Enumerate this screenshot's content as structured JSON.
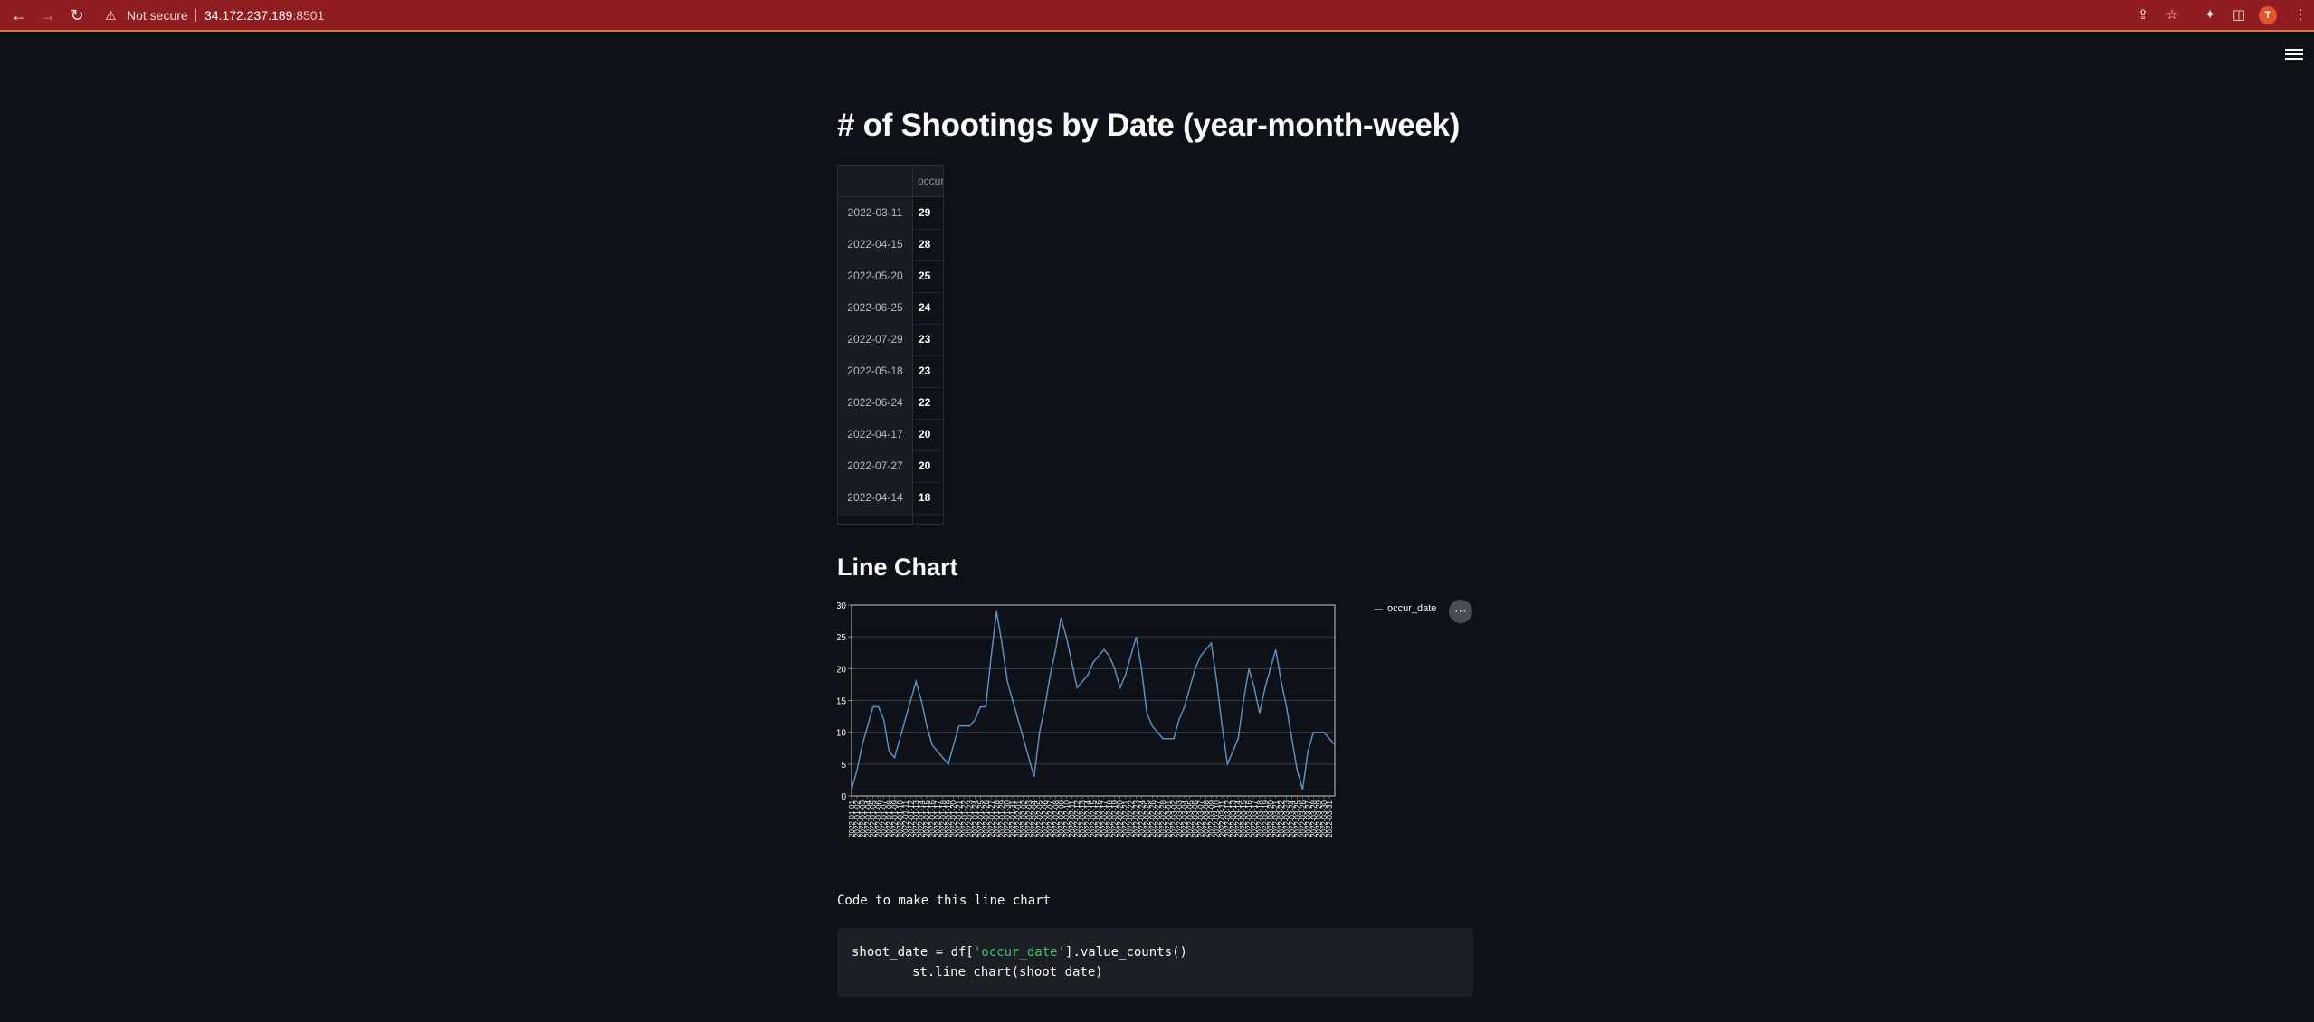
{
  "browser": {
    "security_label": "Not secure",
    "url_host": "34.172.237.189",
    "url_port": ":8501",
    "avatar_letter": "T"
  },
  "page": {
    "title": "# of Shootings by Date (year-month-week)",
    "line_chart_heading": "Line Chart",
    "code_label": "Code to make this line chart",
    "code_line1_a": "shoot_date = df[",
    "code_line1_str": "'occur_date'",
    "code_line1_b": "].value_counts()",
    "code_line2": "st.line_chart(shoot_date)"
  },
  "dataframe": {
    "column_header": "occur_date",
    "rows": [
      {
        "index": "2022-03-11",
        "value": "29"
      },
      {
        "index": "2022-04-15",
        "value": "28"
      },
      {
        "index": "2022-05-20",
        "value": "25"
      },
      {
        "index": "2022-06-25",
        "value": "24"
      },
      {
        "index": "2022-07-29",
        "value": "23"
      },
      {
        "index": "2022-05-18",
        "value": "23"
      },
      {
        "index": "2022-06-24",
        "value": "22"
      },
      {
        "index": "2022-04-17",
        "value": "20"
      },
      {
        "index": "2022-07-27",
        "value": "20"
      },
      {
        "index": "2022-04-14",
        "value": "18"
      }
    ]
  },
  "chart_data": {
    "type": "line",
    "legend": "occur_date",
    "legend_position": "top-right",
    "ylim": [
      0,
      30
    ],
    "yticks": [
      0,
      5,
      10,
      15,
      20,
      25,
      30
    ],
    "grid": true,
    "line_color": "#5c8ec0",
    "x": [
      "2022-01-01",
      "2022-01-02",
      "2022-01-03",
      "2022-01-04",
      "2022-01-05",
      "2022-01-06",
      "2022-01-07",
      "2022-01-08",
      "2022-01-09",
      "2022-01-10",
      "2022-01-11",
      "2022-01-12",
      "2022-01-13",
      "2022-01-14",
      "2022-01-15",
      "2022-01-16",
      "2022-01-17",
      "2022-01-18",
      "2022-01-19",
      "2022-01-20",
      "2022-01-21",
      "2022-01-22",
      "2022-01-23",
      "2022-01-24",
      "2022-01-25",
      "2022-01-26",
      "2022-01-27",
      "2022-01-28",
      "2022-01-29",
      "2022-01-30",
      "2022-01-31",
      "2022-02-01",
      "2022-02-02",
      "2022-02-03",
      "2022-02-04",
      "2022-02-05",
      "2022-02-06",
      "2022-02-07",
      "2022-02-08",
      "2022-02-09",
      "2022-02-10",
      "2022-02-11",
      "2022-02-12",
      "2022-02-13",
      "2022-02-14",
      "2022-02-15",
      "2022-02-16",
      "2022-02-17",
      "2022-02-18",
      "2022-02-19",
      "2022-02-20",
      "2022-02-21",
      "2022-02-22",
      "2022-02-23",
      "2022-02-24",
      "2022-02-25",
      "2022-02-26",
      "2022-02-27",
      "2022-02-28",
      "2022-03-01",
      "2022-03-02",
      "2022-03-03",
      "2022-03-04",
      "2022-03-05",
      "2022-03-06",
      "2022-03-07",
      "2022-03-08",
      "2022-03-09",
      "2022-03-10",
      "2022-03-11",
      "2022-03-12",
      "2022-03-13",
      "2022-03-14",
      "2022-03-15",
      "2022-03-16",
      "2022-03-17",
      "2022-03-18",
      "2022-03-19",
      "2022-03-20",
      "2022-03-21",
      "2022-03-22",
      "2022-03-23",
      "2022-03-24",
      "2022-03-25",
      "2022-03-26",
      "2022-03-27",
      "2022-03-28",
      "2022-03-29",
      "2022-03-30",
      "2022-03-31"
    ],
    "values": [
      1,
      4,
      8,
      11,
      14,
      14,
      12,
      7,
      6,
      9,
      12,
      15,
      18,
      15,
      11,
      8,
      7,
      6,
      5,
      8,
      11,
      11,
      11,
      12,
      14,
      14,
      22,
      29,
      24,
      18,
      15,
      12,
      9,
      6,
      3,
      10,
      14,
      19,
      23,
      28,
      25,
      21,
      17,
      18,
      19,
      21,
      22,
      23,
      22,
      20,
      17,
      19,
      22,
      25,
      20,
      13,
      11,
      10,
      9,
      9,
      9,
      12,
      14,
      17,
      20,
      22,
      23,
      24,
      18,
      11,
      5,
      7,
      9,
      15,
      20,
      17,
      13,
      17,
      20,
      23,
      18,
      14,
      9,
      4,
      1,
      7,
      10,
      10,
      10,
      9,
      8
    ],
    "xtick_labels": [
      "2022-01-01",
      "2022-01-02",
      "2022-01-03",
      "2022-01-04",
      "2022-01-05",
      "2022-01-06",
      "2022-01-07",
      "2022-01-08",
      "2022-01-09",
      "2022-01-10",
      "2022-01-11",
      "2022-01-12",
      "2022-01-13",
      "2022-01-14",
      "2022-01-15",
      "2022-01-16",
      "2022-01-17",
      "2022-01-18",
      "2022-01-19",
      "2022-01-20",
      "2022-01-21",
      "2022-01-22",
      "2022-01-23",
      "2022-01-24",
      "2022-01-25",
      "2022-01-26",
      "2022-01-27",
      "2022-01-28",
      "2022-01-29",
      "2022-01-30",
      "2022-01-31",
      "2022-02-01",
      "2022-02-02",
      "2022-02-03",
      "2022-02-04",
      "2022-02-05",
      "2022-02-06",
      "2022-02-07",
      "2022-02-08",
      "2022-02-09",
      "2022-02-10",
      "2022-02-11",
      "2022-02-12",
      "2022-02-13",
      "2022-02-14",
      "2022-02-15",
      "2022-02-16",
      "2022-02-17",
      "2022-02-18",
      "2022-02-19",
      "2022-02-20",
      "2022-02-21",
      "2022-02-22",
      "2022-02-23",
      "2022-02-24",
      "2022-02-25",
      "2022-02-26",
      "2022-02-27",
      "2022-02-28",
      "2022-03-01",
      "2022-03-02",
      "2022-03-03",
      "2022-03-04",
      "2022-03-05",
      "2022-03-06",
      "2022-03-07",
      "2022-03-08",
      "2022-03-09",
      "2022-03-10",
      "2022-03-11",
      "2022-03-12",
      "2022-03-13",
      "2022-03-14",
      "2022-03-15",
      "2022-03-16",
      "2022-03-17",
      "2022-03-18",
      "2022-03-19",
      "2022-03-20",
      "2022-03-21",
      "2022-03-22",
      "2022-03-23",
      "2022-03-24",
      "2022-03-25",
      "2022-03-26",
      "2022-03-27",
      "2022-03-28",
      "2022-03-29",
      "2022-03-30",
      "2022-03-31"
    ]
  }
}
